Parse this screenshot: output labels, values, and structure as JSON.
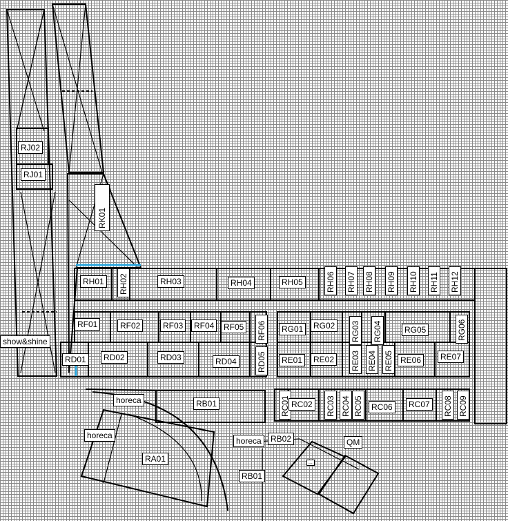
{
  "labels": {
    "rj02": "RJ02",
    "rj01": "RJ01",
    "rk01": "RK01",
    "rh01": "RH01",
    "rh02": "RH02",
    "rh03": "RH03",
    "rh04": "RH04",
    "rh05": "RH05",
    "rh06": "RH06",
    "rh07": "RH07",
    "rh08": "RH08",
    "rh09": "RH09",
    "rh10": "RH10",
    "rh11": "RH11",
    "rh12": "RH12",
    "rf01": "RF01",
    "rf02": "RF02",
    "rf03": "RF03",
    "rf04": "RF04",
    "rf05": "RF05",
    "rf06": "RF06",
    "rg01": "RG01",
    "rg02": "RG02",
    "rg03": "RG03",
    "rg04": "RG04",
    "rg05": "RG05",
    "rg06": "RG06",
    "show_shine": "show&shine",
    "rd01": "RD01",
    "rd02": "RD02",
    "rd03": "RD03",
    "rd04": "RD04",
    "rd05": "RD05",
    "re01": "RE01",
    "re02": "RE02",
    "re03": "RE03",
    "re04": "RE04",
    "re05": "RE05",
    "re06": "RE06",
    "re07": "RE07",
    "horeca_1": "horeca",
    "rb01_top": "RB01",
    "rc01": "RC01",
    "rc02": "RC02",
    "rc03": "RC03",
    "rc04": "RC04",
    "rc05": "RC05",
    "rc06": "RC06",
    "rc07": "RC07",
    "rc08": "RC08",
    "rc09": "RC09",
    "horeca_2": "horeca",
    "horeca_3": "horeca",
    "rb02": "RB02",
    "qm": "QM",
    "ra01": "RA01",
    "rb01_bottom": "RB01",
    "small_box": "..."
  },
  "colors": {
    "highlight": "#29a8e0",
    "grid": "#8a8a8a",
    "line": "#000000"
  }
}
